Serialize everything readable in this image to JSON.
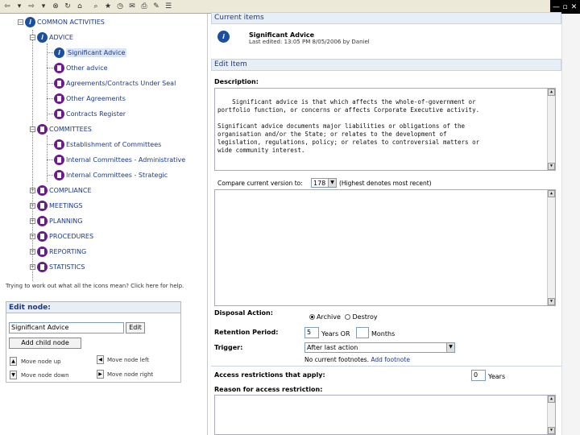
{
  "toolbar": {
    "icons": [
      "back-icon",
      "dropdown-icon",
      "forward-icon",
      "dropdown-icon",
      "stop-icon",
      "refresh-icon",
      "home-icon",
      "search-icon",
      "favorites-icon",
      "history-icon",
      "mail-icon",
      "print-icon",
      "edit-icon",
      "discuss-icon"
    ],
    "window_controls": [
      "—",
      "▫",
      "✕"
    ]
  },
  "tree": {
    "root": "COMMON ACTIVITIES",
    "advice": "ADVICE",
    "advice_children": [
      "Significant Advice",
      "Other advice",
      "Agreements/Contracts Under Seal",
      "Other Agreements",
      "Contracts Register"
    ],
    "committees": "COMMITTEES",
    "committees_children": [
      "Establishment of Committees",
      "Internal Committees - Administrative",
      "Internal Committees - Strategic"
    ],
    "others": [
      "COMPLIANCE",
      "MEETINGS",
      "PLANNING",
      "PROCEDURES",
      "REPORTING",
      "STATISTICS"
    ]
  },
  "hint": "Trying to work out what all the icons mean? Click here for help.",
  "edit_node": {
    "title": "Edit node:",
    "name_value": "Significant Advice",
    "edit_label": "Edit",
    "add_child_label": "Add child node",
    "move_up": "Move node up",
    "move_left": "Move node left",
    "move_down": "Move node down",
    "move_right": "Move node right"
  },
  "current_items": {
    "title": "Current items",
    "item_name": "Significant Advice",
    "item_meta": "Last edited: 13:05 PM 8/05/2006 by Daniel"
  },
  "edit_item": {
    "title": "Edit Item",
    "description_label": "Description:",
    "description_text": "Significant advice is that which affects the whole-of-government or\nportfolio function, or concerns or affects Corporate Executive activity.\n\nSignificant advice documents major liabilities or obligations of the\norganisation and/or the State; or relates to the development of\nlegislation, regulations, policy; or relates to controversial matters or\nwide community interest.",
    "compare_label": "Compare current version to:",
    "compare_value": "178",
    "compare_note": "(Highest denotes most recent)",
    "disposal_label": "Disposal Action:",
    "disposal_options": [
      "Archive",
      "Destroy"
    ],
    "disposal_selected": "Archive",
    "retention_label": "Retention Period:",
    "retention_years": "5",
    "years_or": "Years OR",
    "retention_months": "",
    "months": "Months",
    "trigger_label": "Trigger:",
    "trigger_value": "After last action",
    "footnotes_text": "No current footnotes.",
    "add_footnote": "Add footnote",
    "access_label": "Access restrictions that apply:",
    "access_years": "0",
    "years": "Years",
    "reason_label": "Reason for access restriction:"
  }
}
